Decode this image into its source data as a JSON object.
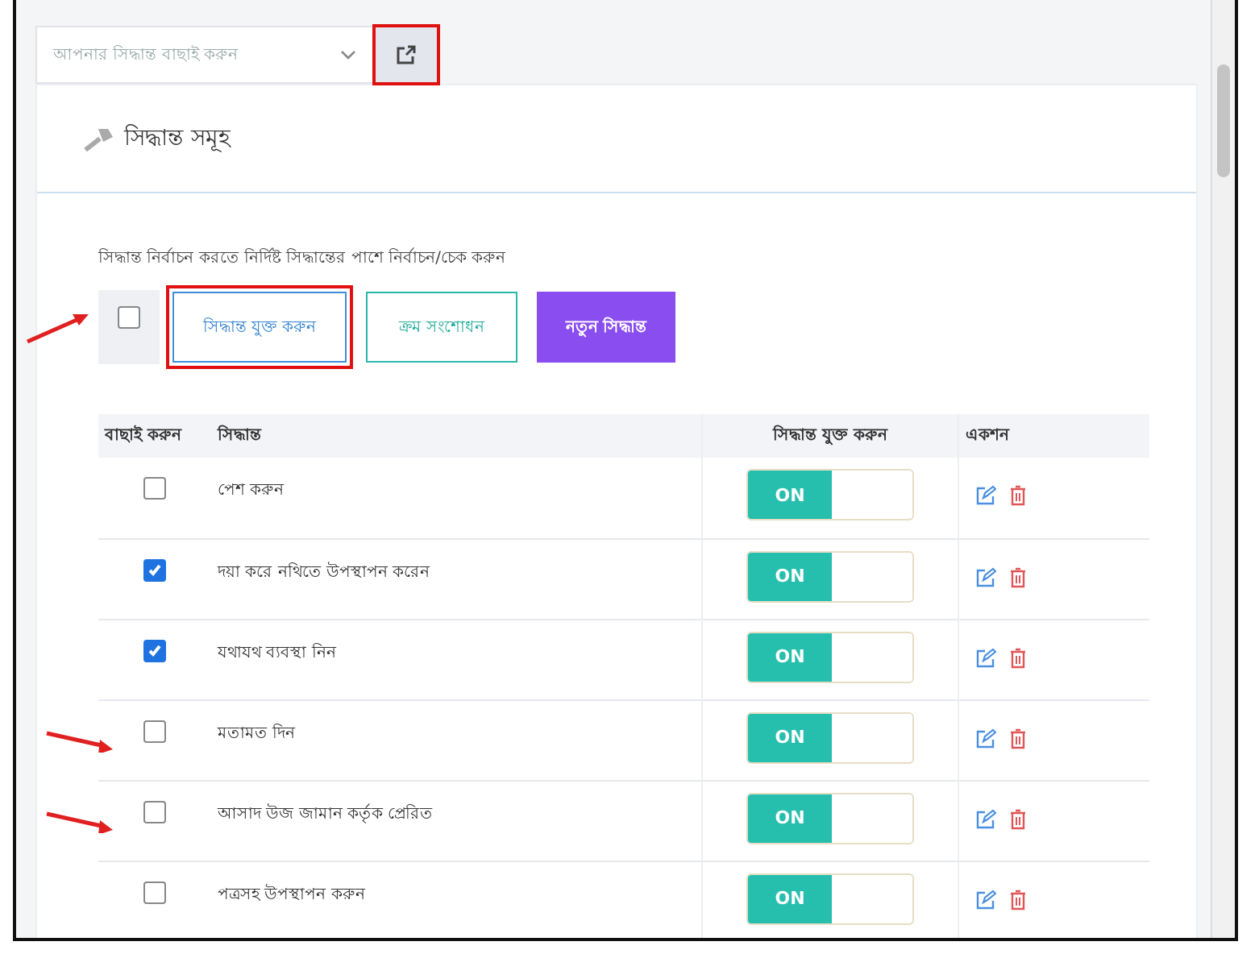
{
  "decision_select": {
    "placeholder": "আপনার সিদ্ধান্ত বাছাই করুন",
    "open_button_highlighted": true
  },
  "card": {
    "title": "সিদ্ধান্ত সমূহ",
    "hint": "সিদ্ধান্ত নির্বাচন করতে নির্দিষ্ট সিদ্ধান্তের পাশে নির্বাচন/চেক করুন",
    "select_all": {
      "checked": false,
      "arrow": true
    },
    "buttons": [
      {
        "label": "সিদ্ধান্ত যুক্ত করুন",
        "kind": "outline-blue",
        "highlighted": true
      },
      {
        "label": "ক্রম সংশোধন",
        "kind": "outline-teal",
        "highlighted": false
      },
      {
        "label": "নতুন সিদ্ধান্ত",
        "kind": "solid-purple",
        "highlighted": false
      }
    ]
  },
  "table": {
    "columns": [
      "বাছাই করুন",
      "সিদ্ধান্ত",
      "সিদ্ধান্ত যুক্ত করুন",
      "একশন"
    ],
    "rows": [
      {
        "checked": false,
        "arrow": false,
        "decision": "পেশ করুন",
        "toggle": {
          "label": "ON",
          "on": true
        }
      },
      {
        "checked": true,
        "arrow": false,
        "decision": "দয়া করে নথিতে উপস্থাপন করেন",
        "toggle": {
          "label": "ON",
          "on": true
        }
      },
      {
        "checked": true,
        "arrow": false,
        "decision": "যথাযথ ব্যবস্থা নিন",
        "toggle": {
          "label": "ON",
          "on": true
        }
      },
      {
        "checked": false,
        "arrow": true,
        "decision": "মতামত দিন",
        "toggle": {
          "label": "ON",
          "on": true
        }
      },
      {
        "checked": false,
        "arrow": true,
        "decision": "আসাদ উজ জামান কর্তৃক প্রেরিত",
        "toggle": {
          "label": "ON",
          "on": true
        }
      },
      {
        "checked": false,
        "arrow": false,
        "decision": "পত্রসহ উপস্থাপন করুন",
        "toggle": {
          "label": "ON",
          "on": true
        }
      }
    ]
  }
}
